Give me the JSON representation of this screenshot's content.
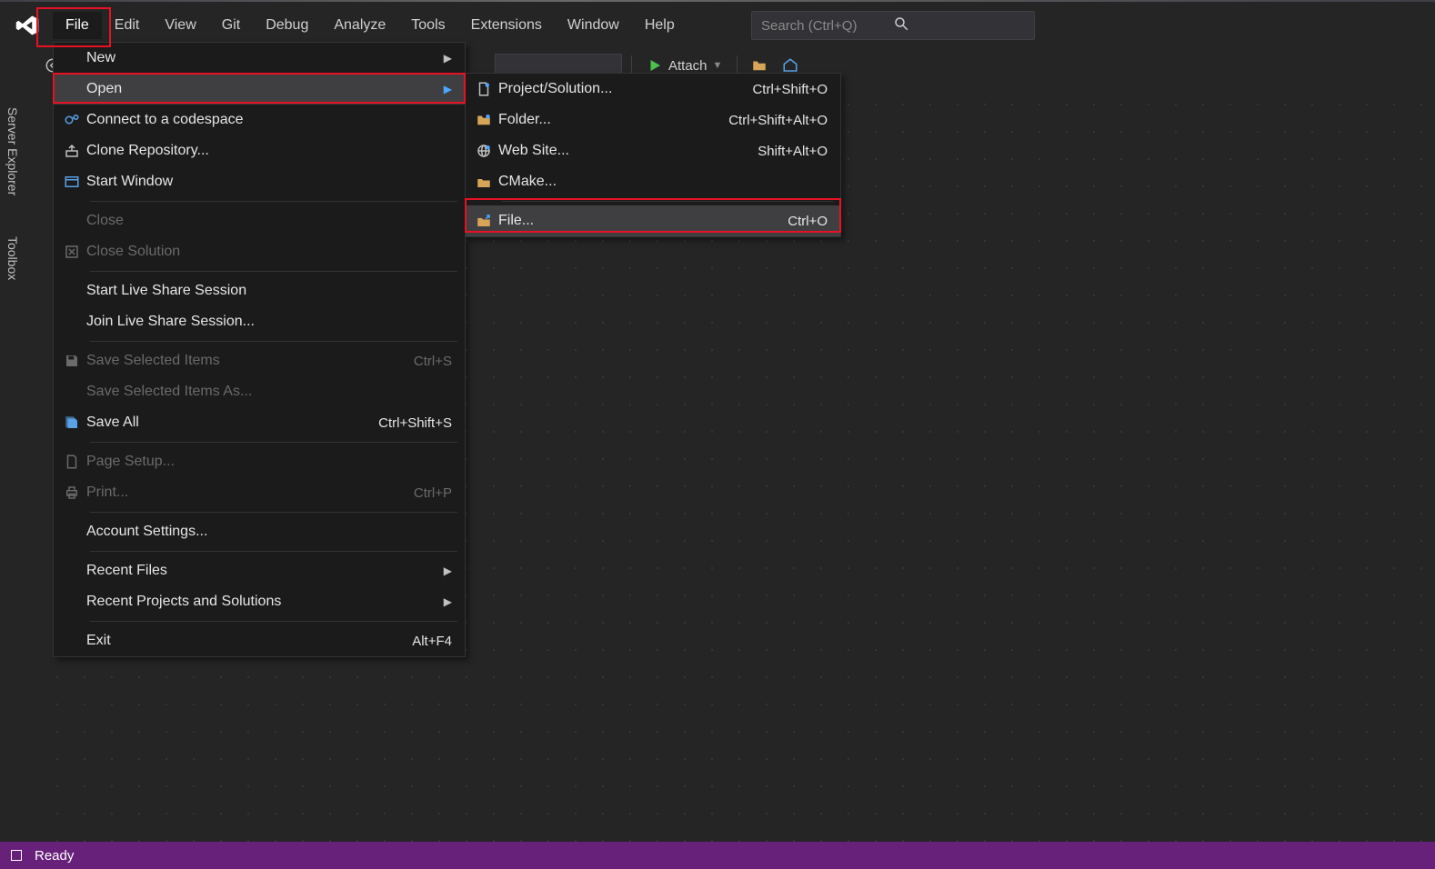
{
  "menubar": {
    "items": [
      "File",
      "Edit",
      "View",
      "Git",
      "Debug",
      "Analyze",
      "Tools",
      "Extensions",
      "Window",
      "Help"
    ],
    "active_index": 0,
    "search_placeholder": "Search (Ctrl+Q)"
  },
  "toolbar": {
    "attach_label": "Attach"
  },
  "side_tabs": {
    "server": "Server Explorer",
    "toolbox": "Toolbox"
  },
  "file_menu": {
    "items": [
      {
        "label": "New",
        "submenu": true
      },
      {
        "label": "Open",
        "submenu": true,
        "hover": true
      },
      {
        "label": "Connect to a codespace",
        "icon": "connect"
      },
      {
        "label": "Clone Repository...",
        "icon": "clone"
      },
      {
        "label": "Start Window",
        "icon": "window"
      },
      {
        "sep": true
      },
      {
        "label": "Close",
        "disabled": true
      },
      {
        "label": "Close Solution",
        "disabled": true,
        "icon": "close-solution"
      },
      {
        "sep": true
      },
      {
        "label": "Start Live Share Session"
      },
      {
        "label": "Join Live Share Session..."
      },
      {
        "sep": true
      },
      {
        "label": "Save Selected Items",
        "shortcut": "Ctrl+S",
        "disabled": true,
        "icon": "save"
      },
      {
        "label": "Save Selected Items As...",
        "disabled": true
      },
      {
        "label": "Save All",
        "shortcut": "Ctrl+Shift+S",
        "icon": "save-all"
      },
      {
        "sep": true
      },
      {
        "label": "Page Setup...",
        "disabled": true,
        "icon": "page"
      },
      {
        "label": "Print...",
        "shortcut": "Ctrl+P",
        "disabled": true,
        "icon": "print"
      },
      {
        "sep": true
      },
      {
        "label": "Account Settings..."
      },
      {
        "sep": true
      },
      {
        "label": "Recent Files",
        "submenu": true
      },
      {
        "label": "Recent Projects and Solutions",
        "submenu": true
      },
      {
        "sep": true
      },
      {
        "label": "Exit",
        "shortcut": "Alt+F4"
      }
    ]
  },
  "open_submenu": {
    "items": [
      {
        "label": "Project/Solution...",
        "shortcut": "Ctrl+Shift+O",
        "icon": "proj"
      },
      {
        "label": "Folder...",
        "shortcut": "Ctrl+Shift+Alt+O",
        "icon": "folder"
      },
      {
        "label": "Web Site...",
        "shortcut": "Shift+Alt+O",
        "icon": "web"
      },
      {
        "label": "CMake...",
        "icon": "cmake"
      },
      {
        "sep": true
      },
      {
        "label": "File...",
        "shortcut": "Ctrl+O",
        "icon": "file-open",
        "hover": true
      }
    ]
  },
  "statusbar": {
    "text": "Ready"
  }
}
